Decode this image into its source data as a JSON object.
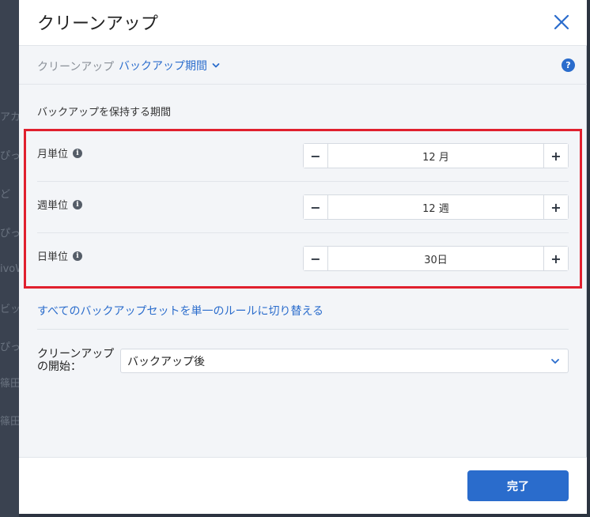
{
  "background_app": {
    "fragments": [
      "アカ",
      "ぴっ",
      "ど ",
      "ぴっ",
      "ivoW",
      "ビッ",
      "ぴっ",
      "篠田",
      "篠田"
    ]
  },
  "dialog": {
    "title": "クリーンアップ",
    "close_icon": "close-icon"
  },
  "breadcrumb": {
    "root": "クリーンアップ",
    "current": "バックアップ期間",
    "help": "?"
  },
  "retention": {
    "section_title": "バックアップを保持する期間",
    "rows": [
      {
        "label": "月単位",
        "value": "12 月",
        "minus": "−",
        "plus": "+"
      },
      {
        "label": "週単位",
        "value": "12 週",
        "minus": "−",
        "plus": "+"
      },
      {
        "label": "日単位",
        "value": "30日",
        "minus": "−",
        "plus": "+"
      }
    ]
  },
  "switch_link": "すべてのバックアップセットを単一のルールに切り替える",
  "start": {
    "label": "クリーンアップの開始：",
    "selected": "バックアップ後"
  },
  "footer": {
    "done_label": "完了"
  },
  "colors": {
    "accent": "#2a6ccc",
    "highlight": "#e0202e"
  }
}
